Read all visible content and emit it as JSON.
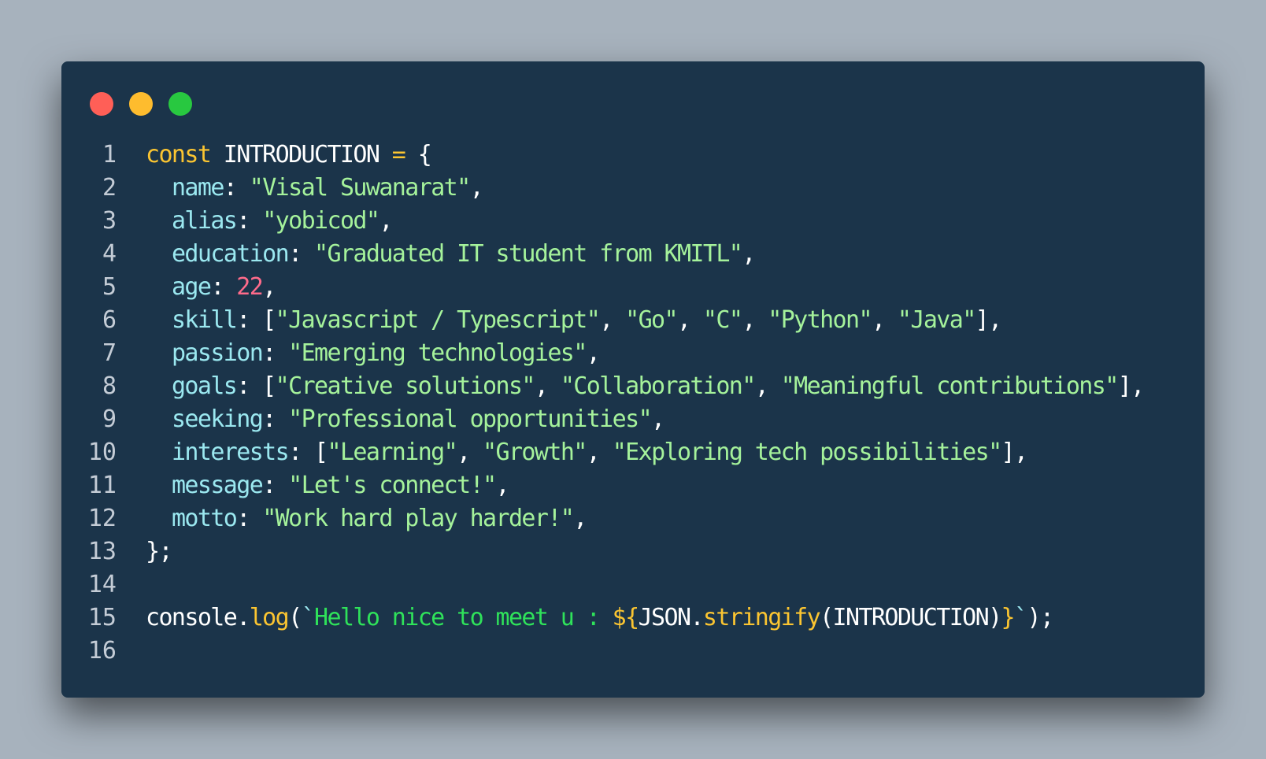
{
  "window": {
    "controls": [
      {
        "name": "close-button",
        "color": "#ff5f57"
      },
      {
        "name": "minimize-button",
        "color": "#febc2e"
      },
      {
        "name": "maximize-button",
        "color": "#28c840"
      }
    ]
  },
  "code": {
    "lines": [
      {
        "n": "1",
        "tokens": [
          {
            "t": "kw",
            "v": "const"
          },
          {
            "t": "id",
            "v": " INTRODUCTION "
          },
          {
            "t": "op",
            "v": "="
          },
          {
            "t": "pn",
            "v": " {"
          }
        ]
      },
      {
        "n": "2",
        "tokens": [
          {
            "t": "pn",
            "v": "  "
          },
          {
            "t": "key",
            "v": "name"
          },
          {
            "t": "pn",
            "v": ": "
          },
          {
            "t": "str",
            "v": "\"Visal Suwanarat\""
          },
          {
            "t": "pn",
            "v": ","
          }
        ]
      },
      {
        "n": "3",
        "tokens": [
          {
            "t": "pn",
            "v": "  "
          },
          {
            "t": "key",
            "v": "alias"
          },
          {
            "t": "pn",
            "v": ": "
          },
          {
            "t": "str",
            "v": "\"yobicod\""
          },
          {
            "t": "pn",
            "v": ","
          }
        ]
      },
      {
        "n": "4",
        "tokens": [
          {
            "t": "pn",
            "v": "  "
          },
          {
            "t": "key",
            "v": "education"
          },
          {
            "t": "pn",
            "v": ": "
          },
          {
            "t": "str",
            "v": "\"Graduated IT student from KMITL\""
          },
          {
            "t": "pn",
            "v": ","
          }
        ]
      },
      {
        "n": "5",
        "tokens": [
          {
            "t": "pn",
            "v": "  "
          },
          {
            "t": "key",
            "v": "age"
          },
          {
            "t": "pn",
            "v": ": "
          },
          {
            "t": "num",
            "v": "22"
          },
          {
            "t": "pn",
            "v": ","
          }
        ]
      },
      {
        "n": "6",
        "tokens": [
          {
            "t": "pn",
            "v": "  "
          },
          {
            "t": "key",
            "v": "skill"
          },
          {
            "t": "pn",
            "v": ": ["
          },
          {
            "t": "str",
            "v": "\"Javascript / Typescript\""
          },
          {
            "t": "pn",
            "v": ", "
          },
          {
            "t": "str",
            "v": "\"Go\""
          },
          {
            "t": "pn",
            "v": ", "
          },
          {
            "t": "str",
            "v": "\"C\""
          },
          {
            "t": "pn",
            "v": ", "
          },
          {
            "t": "str",
            "v": "\"Python\""
          },
          {
            "t": "pn",
            "v": ", "
          },
          {
            "t": "str",
            "v": "\"Java\""
          },
          {
            "t": "pn",
            "v": "],"
          }
        ]
      },
      {
        "n": "7",
        "tokens": [
          {
            "t": "pn",
            "v": "  "
          },
          {
            "t": "key",
            "v": "passion"
          },
          {
            "t": "pn",
            "v": ": "
          },
          {
            "t": "str",
            "v": "\"Emerging technologies\""
          },
          {
            "t": "pn",
            "v": ","
          }
        ]
      },
      {
        "n": "8",
        "tokens": [
          {
            "t": "pn",
            "v": "  "
          },
          {
            "t": "key",
            "v": "goals"
          },
          {
            "t": "pn",
            "v": ": ["
          },
          {
            "t": "str",
            "v": "\"Creative solutions\""
          },
          {
            "t": "pn",
            "v": ", "
          },
          {
            "t": "str",
            "v": "\"Collaboration\""
          },
          {
            "t": "pn",
            "v": ", "
          },
          {
            "t": "str",
            "v": "\"Meaningful contributions\""
          },
          {
            "t": "pn",
            "v": "],"
          }
        ]
      },
      {
        "n": "9",
        "tokens": [
          {
            "t": "pn",
            "v": "  "
          },
          {
            "t": "key",
            "v": "seeking"
          },
          {
            "t": "pn",
            "v": ": "
          },
          {
            "t": "str",
            "v": "\"Professional opportunities\""
          },
          {
            "t": "pn",
            "v": ","
          }
        ]
      },
      {
        "n": "10",
        "tokens": [
          {
            "t": "pn",
            "v": "  "
          },
          {
            "t": "key",
            "v": "interests"
          },
          {
            "t": "pn",
            "v": ": ["
          },
          {
            "t": "str",
            "v": "\"Learning\""
          },
          {
            "t": "pn",
            "v": ", "
          },
          {
            "t": "str",
            "v": "\"Growth\""
          },
          {
            "t": "pn",
            "v": ", "
          },
          {
            "t": "str",
            "v": "\"Exploring tech possibilities\""
          },
          {
            "t": "pn",
            "v": "],"
          }
        ]
      },
      {
        "n": "11",
        "tokens": [
          {
            "t": "pn",
            "v": "  "
          },
          {
            "t": "key",
            "v": "message"
          },
          {
            "t": "pn",
            "v": ": "
          },
          {
            "t": "str",
            "v": "\"Let's connect!\""
          },
          {
            "t": "pn",
            "v": ","
          }
        ]
      },
      {
        "n": "12",
        "tokens": [
          {
            "t": "pn",
            "v": "  "
          },
          {
            "t": "key",
            "v": "motto"
          },
          {
            "t": "pn",
            "v": ": "
          },
          {
            "t": "str",
            "v": "\"Work hard play harder!\""
          },
          {
            "t": "pn",
            "v": ","
          }
        ]
      },
      {
        "n": "13",
        "tokens": [
          {
            "t": "pn",
            "v": "};"
          }
        ]
      },
      {
        "n": "14",
        "tokens": []
      },
      {
        "n": "15",
        "tokens": [
          {
            "t": "id",
            "v": "console"
          },
          {
            "t": "pn",
            "v": "."
          },
          {
            "t": "fn",
            "v": "log"
          },
          {
            "t": "pn",
            "v": "("
          },
          {
            "t": "bt",
            "v": "`"
          },
          {
            "t": "tpl",
            "v": "Hello nice to meet u : "
          },
          {
            "t": "interp",
            "v": "${"
          },
          {
            "t": "id",
            "v": "JSON"
          },
          {
            "t": "pn",
            "v": "."
          },
          {
            "t": "fn",
            "v": "stringify"
          },
          {
            "t": "pn",
            "v": "(INTRODUCTION)"
          },
          {
            "t": "interp",
            "v": "}"
          },
          {
            "t": "bt",
            "v": "`"
          },
          {
            "t": "pn",
            "v": ");"
          }
        ]
      },
      {
        "n": "16",
        "tokens": []
      }
    ]
  }
}
